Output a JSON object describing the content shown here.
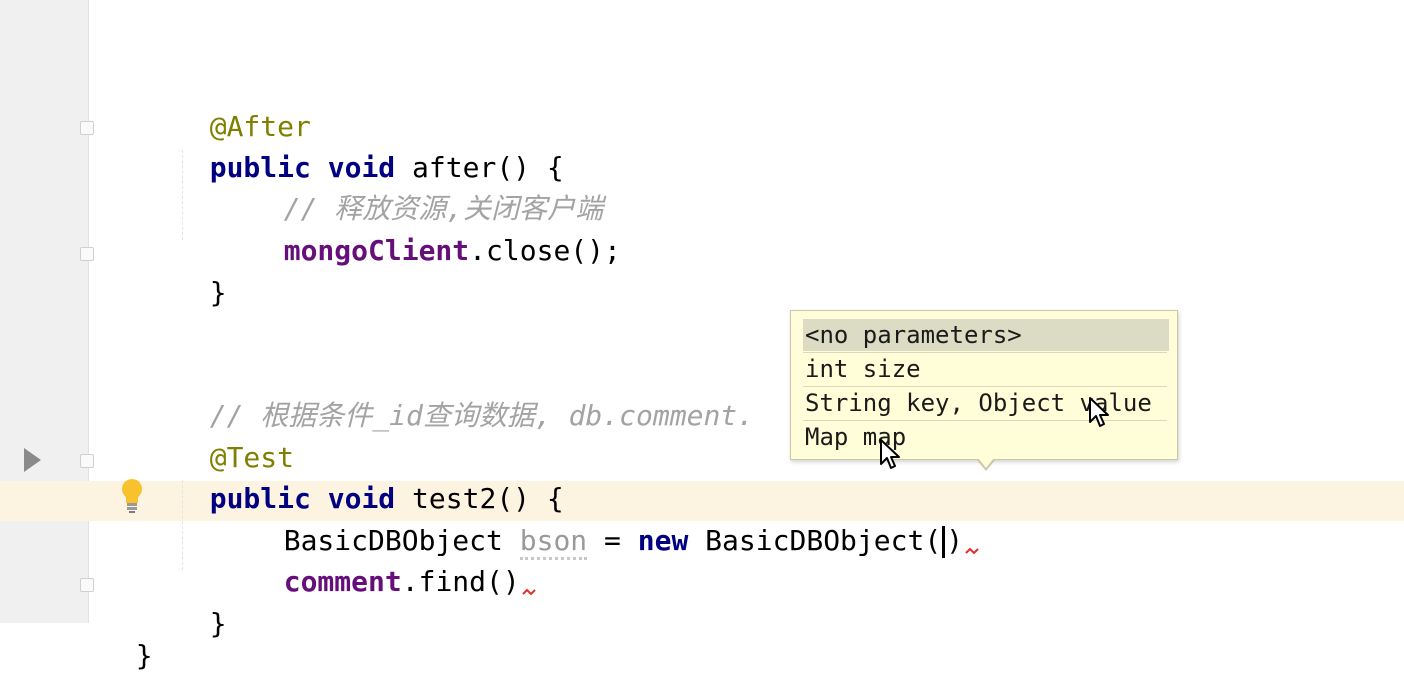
{
  "editor": {
    "lines": {
      "after_annotation": "@After",
      "after_kw_public": "public",
      "after_kw_void": "void",
      "after_sig": "after() {",
      "after_comment": "// 释放资源,关闭客户端",
      "close_field": "mongoClient",
      "close_call": ".close();",
      "brace": "}",
      "query_comment": "// 根据条件_id查询数据, db.comment.",
      "test_annotation": "@Test",
      "test_kw_public": "public",
      "test_kw_void": "void",
      "test_sig": "test2() {",
      "bson_type": "BasicDBObject",
      "bson_var": "bson",
      "bson_eq": " = ",
      "bson_new": "new",
      "bson_ctor": " BasicDBObject(",
      "bson_paren": ")",
      "find_field": "comment",
      "find_call": ".find()",
      "outer_brace": "}"
    }
  },
  "parameter_info_popup": {
    "items": [
      "<no parameters>",
      "int size",
      "String key, Object value",
      "Map map"
    ],
    "selected_index": 0
  },
  "icons": {
    "run": "run-triangle-icon",
    "intention": "lightbulb-icon",
    "cursor": "mouse-pointer-icon"
  },
  "colors": {
    "keyword": "#000080",
    "annotation": "#808000",
    "field": "#660e7a",
    "comment": "#a3a3a3",
    "current_line": "#fdf3e1",
    "popup_bg": "#fffed8"
  }
}
